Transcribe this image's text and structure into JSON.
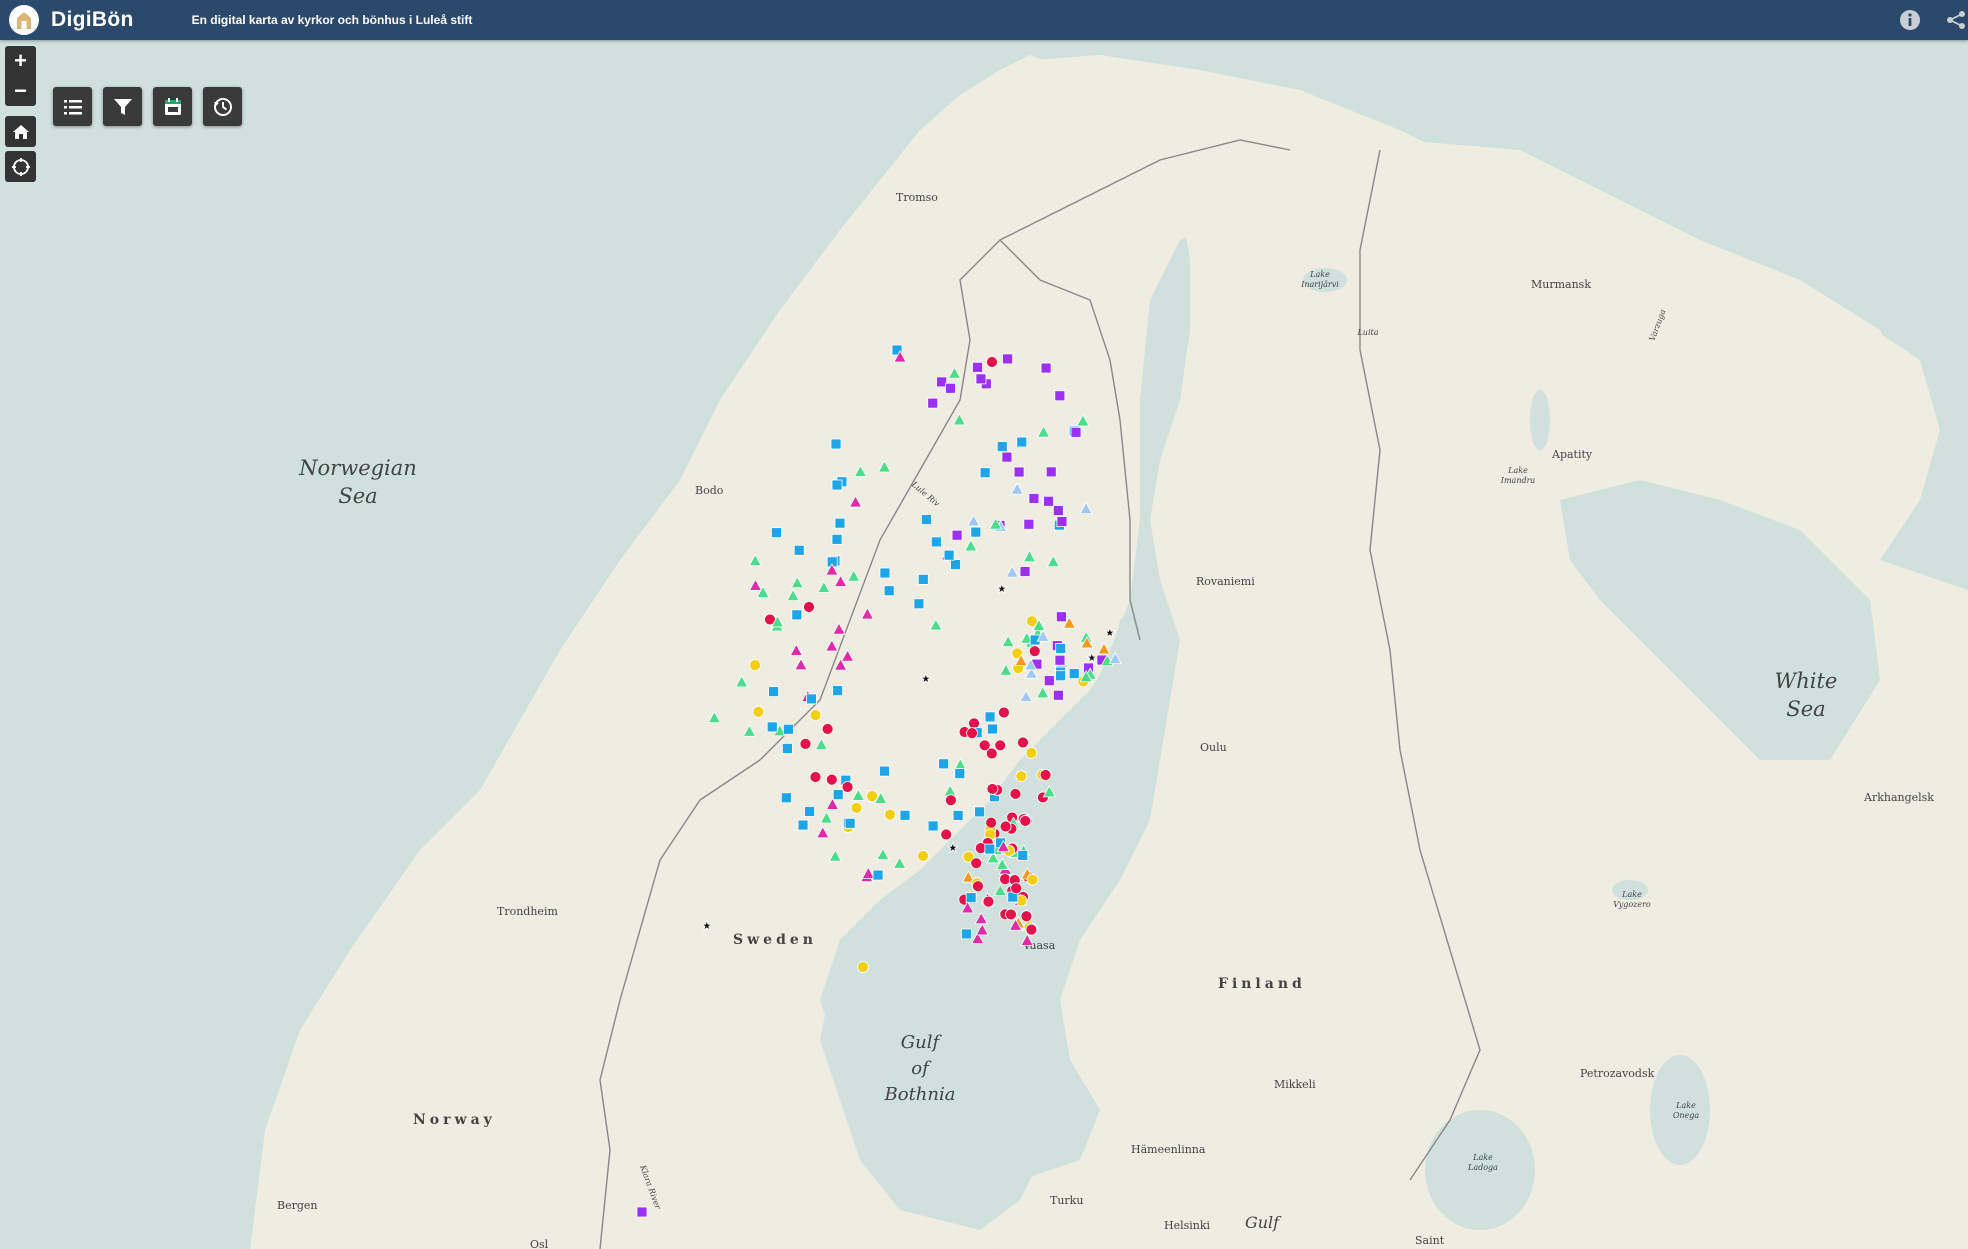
{
  "header": {
    "app_title": "DigiBön",
    "subtitle": "En digital karta av kyrkor och bönhus i Luleå stift",
    "info_icon": "info-icon",
    "share_icon": "share-icon"
  },
  "map_controls": {
    "zoom_in": "+",
    "zoom_out": "−",
    "home_icon": "home-icon",
    "locate_icon": "locate-icon"
  },
  "toolbar": {
    "buttons": [
      "list-icon",
      "filter-icon",
      "calendar-icon",
      "history-icon"
    ]
  },
  "map": {
    "seas": {
      "norwegian_sea_1": "Norwegian",
      "norwegian_sea_2": "Sea",
      "white_sea_1": "White",
      "white_sea_2": "Sea",
      "gulf_1": "Gulf",
      "gulf_2": "of",
      "gulf_3": "Bothnia",
      "gulf_finland": "Gulf"
    },
    "countries": {
      "sweden": "Sweden",
      "norway": "Norway",
      "finland": "Finland"
    },
    "cities": {
      "tromso": "Tromso",
      "murmansk": "Murmansk",
      "bodo": "Bodo",
      "rovaniemi": "Rovaniemi",
      "apatity": "Apatity",
      "oulu": "Oulu",
      "arkhangelsk": "Arkhangelsk",
      "trondheim": "Trondheim",
      "vaasa": "Vaasa",
      "mikkeli": "Mikkeli",
      "petrozavodsk": "Petrozavodsk",
      "hameenlinna": "Hämeenlinna",
      "bergen": "Bergen",
      "turku": "Turku",
      "helsinki": "Helsinki",
      "saint": "Saint",
      "oslo_partial": "Osl"
    },
    "waters": {
      "lake_inari_1": "Lake",
      "lake_inari_2": "Inarijärvi",
      "lake_imandra_1": "Lake",
      "lake_imandra_2": "Imandra",
      "lake_vygozero_1": "Lake",
      "lake_vygozero_2": "Vygozero",
      "lake_onega_1": "Lake",
      "lake_onega_2": "Onega",
      "lake_ladoga_1": "Lake",
      "lake_ladoga_2": "Ladoga",
      "lule_river": "Lule Riv",
      "luita": "Luita",
      "varzuga": "Varzuga",
      "klara_river": "Klara River"
    },
    "marker_colors": {
      "blue_square": "#1ea5e8",
      "purple_square": "#9b30f0",
      "red_circle": "#e4124b",
      "green_triangle": "#4ddc8a",
      "magenta_triangle": "#e02aa8",
      "yellow_circle": "#f2cf12",
      "orange_triangle": "#f39a1e",
      "light_blue_diamond": "#9fc9f0",
      "black_star": "#111111"
    }
  }
}
